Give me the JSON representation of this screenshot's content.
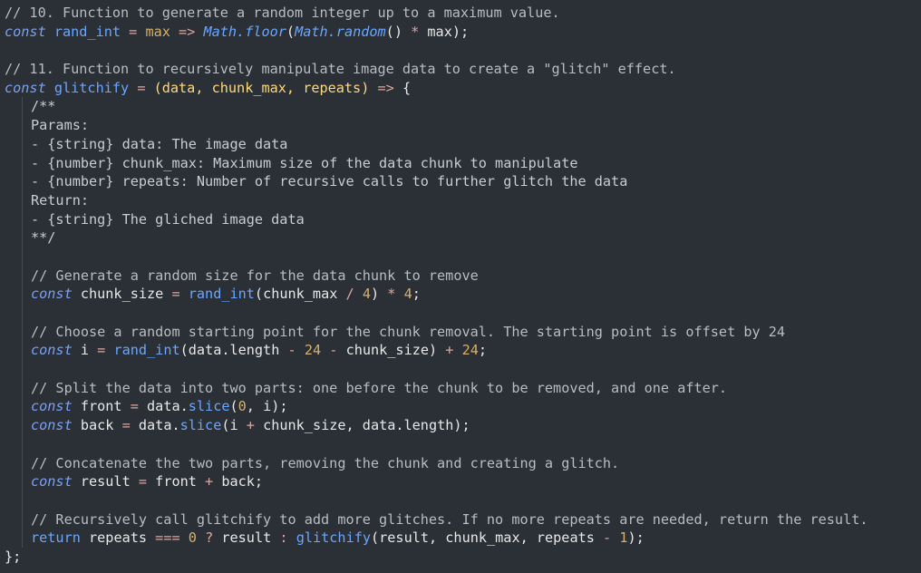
{
  "editor": {
    "language": "javascript",
    "lines": [
      {
        "indent": 0,
        "tokens": [
          {
            "t": "// 10. Function to generate a random integer up to a maximum value.",
            "c": "comment"
          }
        ]
      },
      {
        "indent": 0,
        "tokens": [
          {
            "t": "const",
            "c": "kw"
          },
          {
            "t": " rand_int ",
            "c": "fn"
          },
          {
            "t": "=",
            "c": "op"
          },
          {
            "t": " max ",
            "c": "param"
          },
          {
            "t": "=>",
            "c": "op"
          },
          {
            "t": " ",
            "c": "plain"
          },
          {
            "t": "Math.floor",
            "c": "fn-i"
          },
          {
            "t": "(",
            "c": "plain"
          },
          {
            "t": "Math.random",
            "c": "fn-i"
          },
          {
            "t": "() ",
            "c": "plain"
          },
          {
            "t": "*",
            "c": "op"
          },
          {
            "t": " max);",
            "c": "plain"
          }
        ]
      },
      {
        "indent": 0,
        "tokens": []
      },
      {
        "indent": 0,
        "tokens": [
          {
            "t": "// 11. Function to recursively manipulate image data to create a \"glitch\" effect.",
            "c": "comment"
          }
        ]
      },
      {
        "indent": 0,
        "tokens": [
          {
            "t": "const",
            "c": "kw"
          },
          {
            "t": " glitchify ",
            "c": "fn"
          },
          {
            "t": "=",
            "c": "op"
          },
          {
            "t": " (data, chunk_max, repeats) ",
            "c": "paren"
          },
          {
            "t": "=>",
            "c": "op"
          },
          {
            "t": " {",
            "c": "plain"
          }
        ]
      },
      {
        "indent": 1,
        "tokens": [
          {
            "t": "/**",
            "c": "doc"
          }
        ]
      },
      {
        "indent": 1,
        "tokens": [
          {
            "t": "Params:",
            "c": "doc"
          }
        ]
      },
      {
        "indent": 1,
        "tokens": [
          {
            "t": "- {string} data: The image data",
            "c": "doc"
          }
        ]
      },
      {
        "indent": 1,
        "tokens": [
          {
            "t": "- {number} chunk_max: Maximum size of the data chunk to manipulate",
            "c": "doc"
          }
        ]
      },
      {
        "indent": 1,
        "tokens": [
          {
            "t": "- {number} repeats: Number of recursive calls to further glitch the data",
            "c": "doc"
          }
        ]
      },
      {
        "indent": 1,
        "tokens": [
          {
            "t": "Return:",
            "c": "doc"
          }
        ]
      },
      {
        "indent": 1,
        "tokens": [
          {
            "t": "- {string} The gliched image data",
            "c": "doc"
          }
        ]
      },
      {
        "indent": 1,
        "tokens": [
          {
            "t": "**/",
            "c": "doc"
          }
        ]
      },
      {
        "indent": 1,
        "tokens": []
      },
      {
        "indent": 1,
        "tokens": [
          {
            "t": "// Generate a random size for the data chunk to remove",
            "c": "comment"
          }
        ]
      },
      {
        "indent": 1,
        "tokens": [
          {
            "t": "const",
            "c": "kw"
          },
          {
            "t": " chunk_size ",
            "c": "plain"
          },
          {
            "t": "=",
            "c": "op"
          },
          {
            "t": " ",
            "c": "plain"
          },
          {
            "t": "rand_int",
            "c": "fn"
          },
          {
            "t": "(chunk_max ",
            "c": "plain"
          },
          {
            "t": "/",
            "c": "op"
          },
          {
            "t": " ",
            "c": "plain"
          },
          {
            "t": "4",
            "c": "num"
          },
          {
            "t": ") ",
            "c": "plain"
          },
          {
            "t": "*",
            "c": "op"
          },
          {
            "t": " ",
            "c": "plain"
          },
          {
            "t": "4",
            "c": "num"
          },
          {
            "t": ";",
            "c": "plain"
          }
        ]
      },
      {
        "indent": 1,
        "tokens": []
      },
      {
        "indent": 1,
        "tokens": [
          {
            "t": "// Choose a random starting point for the chunk removal. The starting point is offset by 24",
            "c": "comment"
          }
        ]
      },
      {
        "indent": 1,
        "tokens": [
          {
            "t": "const",
            "c": "kw"
          },
          {
            "t": " i ",
            "c": "plain"
          },
          {
            "t": "=",
            "c": "op"
          },
          {
            "t": " ",
            "c": "plain"
          },
          {
            "t": "rand_int",
            "c": "fn"
          },
          {
            "t": "(data.length ",
            "c": "plain"
          },
          {
            "t": "-",
            "c": "op"
          },
          {
            "t": " ",
            "c": "plain"
          },
          {
            "t": "24",
            "c": "num"
          },
          {
            "t": " ",
            "c": "plain"
          },
          {
            "t": "-",
            "c": "op"
          },
          {
            "t": " chunk_size) ",
            "c": "plain"
          },
          {
            "t": "+",
            "c": "op"
          },
          {
            "t": " ",
            "c": "plain"
          },
          {
            "t": "24",
            "c": "num"
          },
          {
            "t": ";",
            "c": "plain"
          }
        ]
      },
      {
        "indent": 1,
        "tokens": []
      },
      {
        "indent": 1,
        "tokens": [
          {
            "t": "// Split the data into two parts: one before the chunk to be removed, and one after.",
            "c": "comment"
          }
        ]
      },
      {
        "indent": 1,
        "tokens": [
          {
            "t": "const",
            "c": "kw"
          },
          {
            "t": " front ",
            "c": "plain"
          },
          {
            "t": "=",
            "c": "op"
          },
          {
            "t": " data.",
            "c": "plain"
          },
          {
            "t": "slice",
            "c": "fn"
          },
          {
            "t": "(",
            "c": "plain"
          },
          {
            "t": "0",
            "c": "num"
          },
          {
            "t": ", i);",
            "c": "plain"
          }
        ]
      },
      {
        "indent": 1,
        "tokens": [
          {
            "t": "const",
            "c": "kw"
          },
          {
            "t": " back ",
            "c": "plain"
          },
          {
            "t": "=",
            "c": "op"
          },
          {
            "t": " data.",
            "c": "plain"
          },
          {
            "t": "slice",
            "c": "fn"
          },
          {
            "t": "(i ",
            "c": "plain"
          },
          {
            "t": "+",
            "c": "op"
          },
          {
            "t": " chunk_size, data.length);",
            "c": "plain"
          }
        ]
      },
      {
        "indent": 1,
        "tokens": []
      },
      {
        "indent": 1,
        "tokens": [
          {
            "t": "// Concatenate the two parts, removing the chunk and creating a glitch.",
            "c": "comment"
          }
        ]
      },
      {
        "indent": 1,
        "tokens": [
          {
            "t": "const",
            "c": "kw"
          },
          {
            "t": " result ",
            "c": "plain"
          },
          {
            "t": "=",
            "c": "op"
          },
          {
            "t": " front ",
            "c": "plain"
          },
          {
            "t": "+",
            "c": "op"
          },
          {
            "t": " back;",
            "c": "plain"
          }
        ]
      },
      {
        "indent": 1,
        "tokens": []
      },
      {
        "indent": 1,
        "tokens": [
          {
            "t": "// Recursively call glitchify to add more glitches. If no more repeats are needed, return the result.",
            "c": "comment"
          }
        ]
      },
      {
        "indent": 1,
        "tokens": [
          {
            "t": "return",
            "c": "ret"
          },
          {
            "t": " repeats ",
            "c": "plain"
          },
          {
            "t": "===",
            "c": "op"
          },
          {
            "t": " ",
            "c": "plain"
          },
          {
            "t": "0",
            "c": "num"
          },
          {
            "t": " ",
            "c": "plain"
          },
          {
            "t": "?",
            "c": "op"
          },
          {
            "t": " result ",
            "c": "plain"
          },
          {
            "t": ":",
            "c": "op"
          },
          {
            "t": " ",
            "c": "plain"
          },
          {
            "t": "glitchify",
            "c": "fn"
          },
          {
            "t": "(result, chunk_max, repeats ",
            "c": "plain"
          },
          {
            "t": "-",
            "c": "op"
          },
          {
            "t": " ",
            "c": "plain"
          },
          {
            "t": "1",
            "c": "num"
          },
          {
            "t": ");",
            "c": "plain"
          }
        ]
      },
      {
        "indent": 0,
        "tokens": [
          {
            "t": "};",
            "c": "plain"
          }
        ]
      }
    ]
  }
}
